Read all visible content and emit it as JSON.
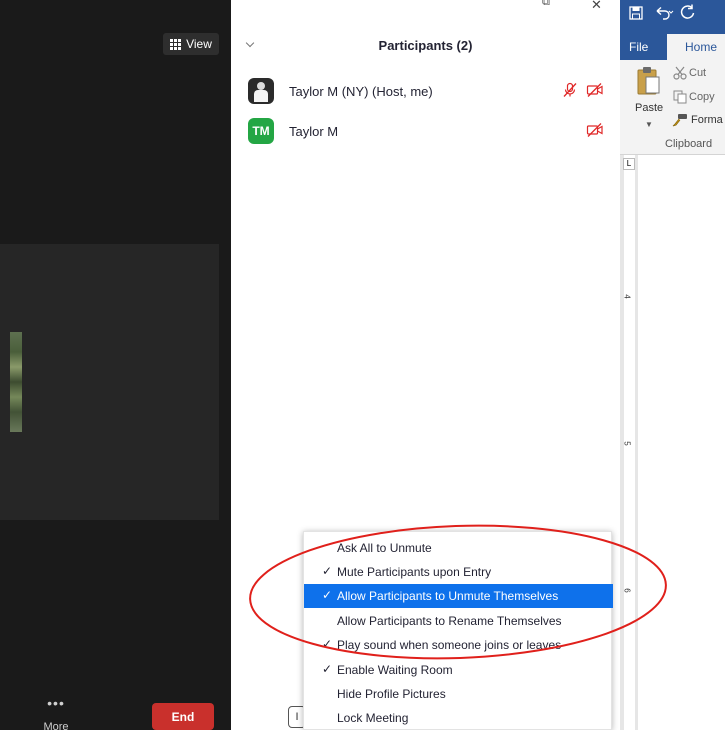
{
  "video": {
    "view_label": "View",
    "more_dots": "•••",
    "more_label": "More",
    "end_label": "End"
  },
  "panel": {
    "title": "Participants (2)",
    "restore_glyph": "⧉",
    "close_glyph": "✕"
  },
  "participants": [
    {
      "name": "Taylor M (NY) (Host, me)",
      "avatar": "photo",
      "muted": true,
      "video_off": true
    },
    {
      "name": "Taylor M",
      "avatar": "initials",
      "initials": "TM",
      "video_off": true
    }
  ],
  "menu": {
    "dropdown_glyph": "I",
    "items": [
      {
        "label": "Ask All to Unmute",
        "checked": false,
        "highlighted": false
      },
      {
        "label": "Mute Participants upon Entry",
        "checked": true,
        "highlighted": false
      },
      {
        "label": "Allow Participants to Unmute Themselves",
        "checked": true,
        "highlighted": true
      },
      {
        "label": "Allow Participants to Rename Themselves",
        "checked": false,
        "highlighted": false
      },
      {
        "label": "Play sound when someone joins or leaves",
        "checked": true,
        "highlighted": false
      },
      {
        "label": "Enable Waiting Room",
        "checked": true,
        "highlighted": false
      },
      {
        "label": "Hide Profile Pictures",
        "checked": false,
        "highlighted": false
      },
      {
        "label": "Lock Meeting",
        "checked": false,
        "highlighted": false
      }
    ],
    "check_glyph": "✓"
  },
  "word": {
    "file_tab": "File",
    "home_tab": "Home",
    "paste": "Paste",
    "cut": "Cut",
    "copy": "Copy",
    "format_painter": "Forma",
    "clipboard": "Clipboard",
    "tab_marker": "L",
    "ruler_numbers": [
      "4",
      "5",
      "6"
    ]
  },
  "colors": {
    "zoom_blue": "#0e71eb",
    "end_red": "#c9302c",
    "mute_red": "#e02828",
    "word_blue": "#2b579a",
    "annotation_red": "#e0201b"
  }
}
